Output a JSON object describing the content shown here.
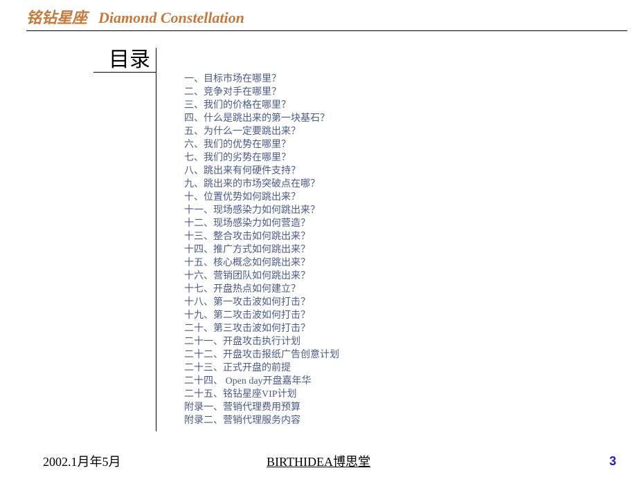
{
  "header": {
    "title_cn": "铭钻星座",
    "title_en": "Diamond Constellation"
  },
  "toc": {
    "title": "目录",
    "items": [
      "一、目标市场在哪里？",
      "二、竞争对手在哪里？",
      "三、我们的价格在哪里？",
      "四、什么是跳出来的第一块基石？",
      "五、为什么一定要跳出来？",
      "六、我们的优势在哪里？",
      "七、我们的劣势在哪里？",
      "八、跳出来有何硬件支持？",
      "九、跳出来的市场突破点在哪？",
      "十、位置优势如何跳出来？",
      "十一、现场感染力如何跳出来？",
      "十二、现场感染力如何营造？",
      "十三、整合攻击如何跳出来？",
      "十四、推广方式如何跳出来？",
      "十五、核心概念如何跳出来？",
      "十六、营销团队如何跳出来？",
      "十七、开盘热点如何建立？",
      "十八、第一攻击波如何打击？",
      "十九、第二攻击波如何打击？",
      "二十、第三攻击波如何打击？",
      "二十一、开盘攻击执行计划",
      "二十二、开盘攻击报纸广告创意计划",
      "二十三、正式开盘的前提",
      "二十四、 Open day开盘嘉年华",
      "二十五、铭钻星座VIP计划",
      "附录一、营销代理费用预算",
      "附录二、营销代理服务内容"
    ]
  },
  "footer": {
    "date": "2002.1月年5月",
    "center": "BIRTHIDEA博思堂",
    "page": "3"
  }
}
